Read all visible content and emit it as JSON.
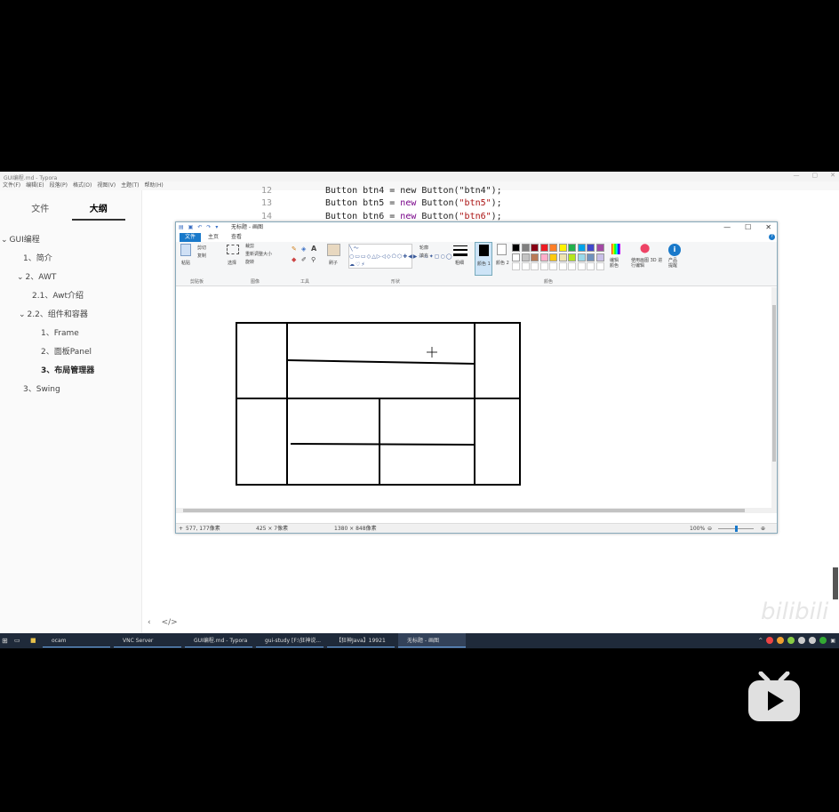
{
  "window": {
    "title": "GUI编程.md - Typora"
  },
  "menu": [
    "文件(F)",
    "编辑(E)",
    "段落(P)",
    "格式(O)",
    "视图(V)",
    "主题(T)",
    "帮助(H)"
  ],
  "sidebar": {
    "tabs": {
      "files": "文件",
      "outline": "大纲"
    },
    "outline": [
      {
        "label": "GUI编程",
        "level": 0,
        "arrow": "⌄"
      },
      {
        "label": "1、简介",
        "level": 1
      },
      {
        "label": "2、AWT",
        "level": 1,
        "arrow": "⌄"
      },
      {
        "label": "2.1、Awt介绍",
        "level": 2
      },
      {
        "label": "2.2、组件和容器",
        "level": 2,
        "arrow": "⌄"
      },
      {
        "label": "1、Frame",
        "level": 3
      },
      {
        "label": "2、面板Panel",
        "level": 3
      },
      {
        "label": "3、布局管理器",
        "level": 3,
        "active": true
      },
      {
        "label": "3、Swing",
        "level": 1
      }
    ],
    "footer": {
      "back": "‹",
      "code": "</>"
    }
  },
  "code": {
    "lines": [
      {
        "num": "12",
        "text": "Button btn4 = new Button(\"btn4\");"
      },
      {
        "num": "13",
        "pre": "Button btn5 = ",
        "kw": "new",
        "mid": " Button(",
        "str": "\"btn5\"",
        "post": ");"
      },
      {
        "num": "14",
        "pre": "Button btn6 = ",
        "kw": "new",
        "mid": " Button(",
        "str": "\"btn6\"",
        "post": ");"
      }
    ]
  },
  "paint": {
    "title": "无标题 - 画图",
    "tabs": {
      "file": "文件",
      "home": "主页",
      "view": "查看"
    },
    "groups": {
      "clipboard": "剪贴板",
      "image": "图像",
      "tools": "工具",
      "shapes": "形状",
      "colors": "颜色"
    },
    "buttons": {
      "paste": "粘贴",
      "cut": "剪切",
      "copy": "复制",
      "select": "选择",
      "crop": "裁剪",
      "resize": "重新调整大小",
      "rotate": "旋转",
      "brushes": "刷子",
      "outline": "轮廓",
      "fill": "填充",
      "size": "粗细",
      "color1": "颜色 1",
      "color2": "颜色 2",
      "edit_colors": "编辑颜色",
      "paint3d": "使用画图 3D 进行编辑",
      "product_alert": "产品提醒"
    },
    "palette_colors": [
      "#000000",
      "#7f7f7f",
      "#880015",
      "#ed1c24",
      "#ff7f27",
      "#fff200",
      "#22b14c",
      "#00a2e8",
      "#3f48cc",
      "#a349a4",
      "#ffffff",
      "#c3c3c3",
      "#b97a57",
      "#ffaec9",
      "#ffc90e",
      "#efe4b0",
      "#b5e61d",
      "#99d9ea",
      "#7092be",
      "#c8bfe7"
    ],
    "status": {
      "cursor": "577, 177像素",
      "selection": "425 × 7像素",
      "size": "1380 × 848像素",
      "zoom": "100%"
    }
  },
  "taskbar": {
    "items": [
      "ocam",
      "VNC Server",
      "GUI编程.md - Typora",
      "gui-study [F:\\狂神说...",
      "【狂神Java】19921",
      "无标题 - 画图"
    ]
  },
  "watermark": "bilibili"
}
